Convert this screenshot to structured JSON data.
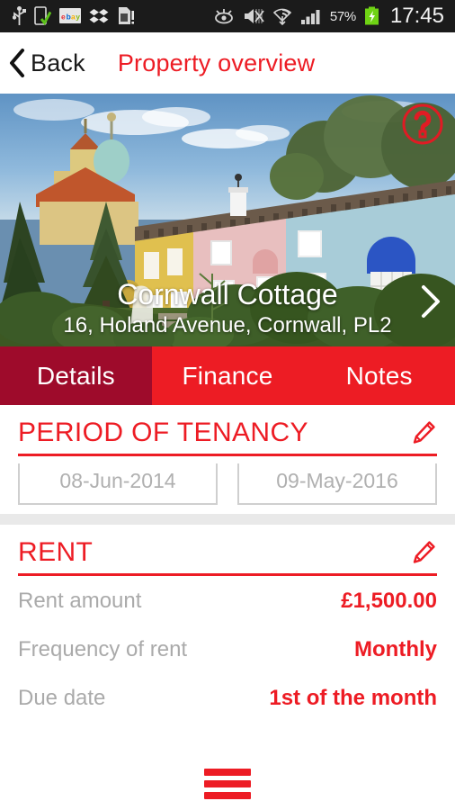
{
  "status_bar": {
    "left_icons": [
      "usb-icon",
      "phone-sync-icon",
      "ebay-icon",
      "dropbox-icon",
      "sd-card-alert-icon"
    ],
    "right_icons": [
      "smart-stay-eye-icon",
      "mute-vibrate-icon",
      "wifi-icon",
      "signal-bars-icon"
    ],
    "battery_percent": "57%",
    "battery_icon": "battery-charging-icon",
    "clock": "17:45"
  },
  "nav": {
    "back_label": "Back",
    "back_icon": "chevron-left-icon",
    "title": "Property overview"
  },
  "hero": {
    "help_icon": "question-mark-circle-icon",
    "next_icon": "chevron-right-icon",
    "property_name": "Cornwall Cottage",
    "property_address": "16, Holand Avenue, Cornwall, PL2"
  },
  "tabs": [
    {
      "label": "Details",
      "active": true
    },
    {
      "label": "Finance",
      "active": false
    },
    {
      "label": "Notes",
      "active": false
    }
  ],
  "tenancy": {
    "title": "PERIOD OF TENANCY",
    "edit_icon": "pencil-edit-icon",
    "start_date": "08-Jun-2014",
    "end_date": "09-May-2016"
  },
  "rent": {
    "title": "RENT",
    "edit_icon": "pencil-edit-icon",
    "rows": [
      {
        "key": "Rent amount",
        "value": "£1,500.00"
      },
      {
        "key": "Frequency of rent",
        "value": "Monthly"
      },
      {
        "key": "Due date",
        "value": "1st of the month"
      }
    ]
  },
  "bottom_bar": {
    "menu_icon": "hamburger-menu-icon"
  },
  "colors": {
    "accent_red": "#ed1c24",
    "active_tab_red": "#9e0b2b",
    "muted_gray": "#aaaaaa",
    "divider_gray": "#e9e9e9",
    "status_bar_black": "#1b1b1b"
  }
}
